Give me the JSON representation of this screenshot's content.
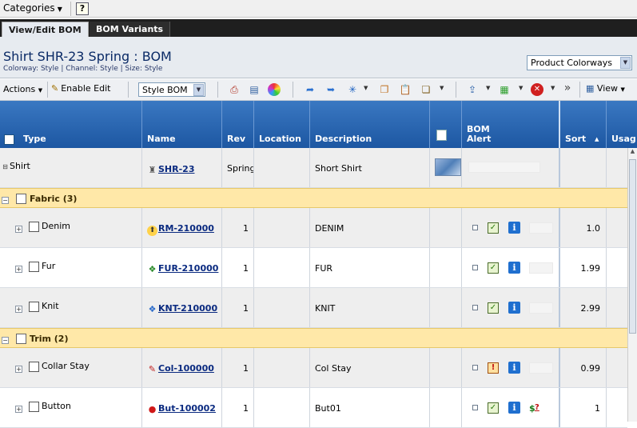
{
  "topbar": {
    "categories_label": "Categories",
    "help_label": "?"
  },
  "tabs": [
    {
      "label": "View/Edit BOM"
    },
    {
      "label": "BOM Variants"
    }
  ],
  "header": {
    "title": "Shirt SHR-23 Spring : BOM",
    "subtitle": "Colorway: Style | Channel: Style | Size: Style",
    "colorways_select": "Product Colorways"
  },
  "toolbar": {
    "actions_label": "Actions",
    "edit_label": "Enable Edit",
    "bom_select": "Style BOM",
    "overflow_label": "»",
    "view_label": "View"
  },
  "columns": {
    "type": "Type",
    "name": "Name",
    "rev": "Rev",
    "location": "Location",
    "description": "Description",
    "bom_alert_1": "BOM",
    "bom_alert_2": "Alert",
    "sort": "Sort",
    "sort_arrow": "▲",
    "usage": "Usag"
  },
  "root": {
    "type": "Shirt",
    "name": "SHR-23",
    "rev": "Spring",
    "description": "Short Shirt"
  },
  "groups": [
    {
      "label": "Fabric (3)"
    },
    {
      "label": "Trim (2)"
    }
  ],
  "rows": [
    {
      "type": "Denim",
      "name": "RM-210000",
      "rev": "1",
      "description": "DENIM",
      "sort": "1.0"
    },
    {
      "type": "Fur",
      "name": "FUR-210000",
      "rev": "1",
      "description": "FUR",
      "sort": "1.99"
    },
    {
      "type": "Knit",
      "name": "KNT-210000",
      "rev": "1",
      "description": "KNIT",
      "sort": "2.99"
    },
    {
      "type": "Collar Stay",
      "name": "Col-100000",
      "rev": "1",
      "description": "Col Stay",
      "sort": "0.99"
    },
    {
      "type": "Button",
      "name": "But-100002",
      "rev": "1",
      "description": "But01",
      "sort": "1"
    }
  ],
  "colors": {
    "header_blue": "#2a68b4",
    "group_band": "#ffe8a8",
    "link": "#0a2a80"
  }
}
